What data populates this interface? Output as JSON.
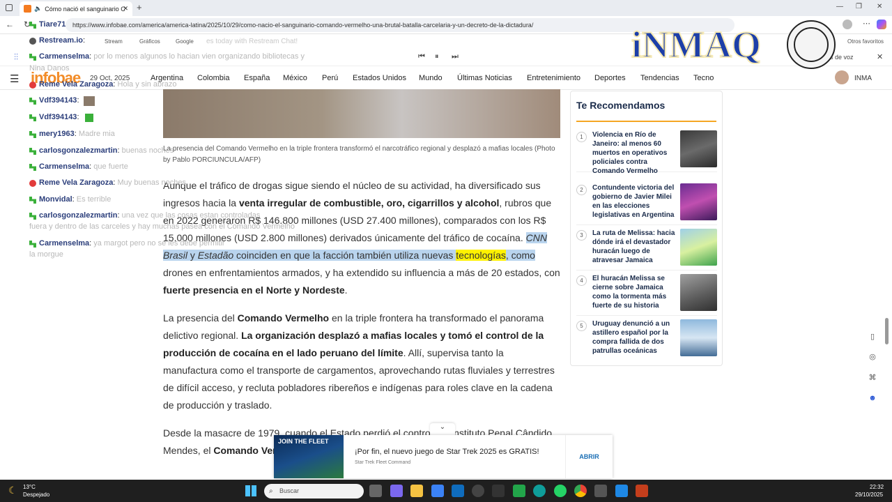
{
  "browser": {
    "tab_title": "Cómo nació el sanguinario C",
    "url": "https://www.infobae.com/america/america-latina/2025/10/29/como-nacio-el-sanguinario-comando-vermelho-una-brutal-batalla-carcelaria-y-un-decreto-de-la-dictadura/",
    "bookmarks": [
      "Stream",
      "Gráficos",
      "Google"
    ],
    "bookmark_prompt": "es today with Restream Chat!",
    "other_favorites": "Otros favoritos",
    "read_aloud": "es de voz"
  },
  "site": {
    "logo": "infobae",
    "date": "29 Oct, 2025",
    "nav": [
      "Argentina",
      "Colombia",
      "España",
      "México",
      "Perú",
      "Estados Unidos",
      "Mundo",
      "Últimas Noticias",
      "Entretenimiento",
      "Deportes",
      "Tendencias",
      "Tecno"
    ],
    "user": "INMA"
  },
  "article": {
    "caption": "La presencia del Comando Vermelho en la triple frontera transformó el narcotráfico regional y desplazó a mafias locales (Photo by Pablo PORCIUNCULA/AFP)",
    "p1": {
      "t1": "Aunque el tráfico de drogas sigue siendo el núcleo de su actividad, ha diversificado sus ingresos hacia la ",
      "b1": "venta irregular de combustible, oro, cigarrillos y alcohol",
      "t2": ", rubros que en 2022 generaron R$ 146.800 millones (USD 27.400 millones), comparados con los R$ 15.000 millones (USD 2.800 millones) derivados únicamente del tráfico de cocaína. ",
      "i1": "CNN Brasil",
      "t3": " y ",
      "i2": "Estadão",
      "t4": " coinciden en que la facción también utiliza nuevas ",
      "y1": "tecnologías",
      "t5": ", como",
      "t6": " drones en enfrentamientos armados, y ha extendido su influencia a más de 20 estados, con ",
      "b2": "fuerte presencia en el Norte y Nordeste",
      "t7": "."
    },
    "p2": {
      "t1": "La presencia del ",
      "b1": "Comando Vermelho",
      "t2": " en la triple frontera ha transformado el panorama delictivo regional. ",
      "b2": "La organización desplazó a mafias locales y tomó el control de la producción de cocaína en el lado peruano del límite",
      "t3": ". Allí, supervisa tanto la manufactura como el transporte de cargamentos, aprovechando rutas fluviales y terrestres de difícil acceso, y recluta pobladores ribereños e indígenas para roles clave en la cadena de producción y traslado."
    },
    "p3": {
      "t1": "Desde la masacre de 1979, cuando el Estado perdió el control del Instituto Penal Cândido Mendes, el ",
      "b1": "Comando Ver"
    }
  },
  "sidebar": {
    "title": "Te Recomendamos",
    "items": [
      {
        "num": "1",
        "text": "Violencia en Río de Janeiro: al menos 60 muertos en operativos policiales contra Comando Vermelho"
      },
      {
        "num": "2",
        "text": "Contundente victoria del gobierno de Javier Milei en las elecciones legislativas en Argentina"
      },
      {
        "num": "3",
        "text": "La ruta de Melissa: hacia dónde irá el devastador huracán luego de atravesar Jamaica"
      },
      {
        "num": "4",
        "text": "El huracán Melissa se cierne sobre Jamaica como la tormenta más fuerte de su historia"
      },
      {
        "num": "5",
        "text": "Uruguay denunció a un astillero español por la compra fallida de dos patrullas oceánicas"
      }
    ]
  },
  "chat": {
    "lines": [
      {
        "who": "Tiare71",
        "msg": "",
        "type": "green"
      },
      {
        "who": "Restream.io",
        "msg": "",
        "type": "other"
      },
      {
        "who": "Carmenselma",
        "msg": "por lo menos algunos lo hacian vien organizando bibliotecas y",
        "type": "green"
      },
      {
        "who": "Reme Vela Zaragoza",
        "msg": "Hola y sin abrazo",
        "type": "red"
      },
      {
        "who": "Vdf394143",
        "msg": "",
        "type": "green"
      },
      {
        "who": "Vdf394143",
        "msg": "",
        "type": "green"
      },
      {
        "who": "mery1963",
        "msg": "Madre mia",
        "type": "green"
      },
      {
        "who": "carlosgonzalezmartin",
        "msg": "buenas noches",
        "type": "green"
      },
      {
        "who": "Carmenselma",
        "msg": "que fuerte",
        "type": "green"
      },
      {
        "who": "Reme Vela Zaragoza",
        "msg": "Muy buenas noches",
        "type": "red"
      },
      {
        "who": "Monvidal",
        "msg": "Es terrible",
        "type": "green"
      },
      {
        "who": "carlosgonzalezmartin",
        "msg": "una vez que las cosas estan controladas",
        "type": "green"
      },
      {
        "who": "Carmenselma",
        "msg": "ya margot pero no se les debe permitir",
        "type": "green"
      }
    ],
    "cont1": "fuera y dentro de las carceles y hay muchas pasea con el Comando Vermelho",
    "cont2": "la morgue",
    "faded_name": "Nina Danos"
  },
  "brand": {
    "text": "iNMAQ"
  },
  "ad": {
    "img_text": "JOIN THE FLEET",
    "title": "¡Por fin, el nuevo juego de Star Trek 2025 es GRATIS!",
    "sub": "Star Trek Fleet Command",
    "button": "ABRIR"
  },
  "taskbar": {
    "temp": "13°C",
    "weather": "Despejado",
    "search": "Buscar",
    "time": "22:32",
    "date": "29/10/2025"
  },
  "colors": {
    "accent": "#f28c28",
    "highlight_blue": "#b9d4ee",
    "highlight_yellow": "#fff200",
    "chat_green": "#3ab03a",
    "chat_red": "#e23b3b"
  }
}
